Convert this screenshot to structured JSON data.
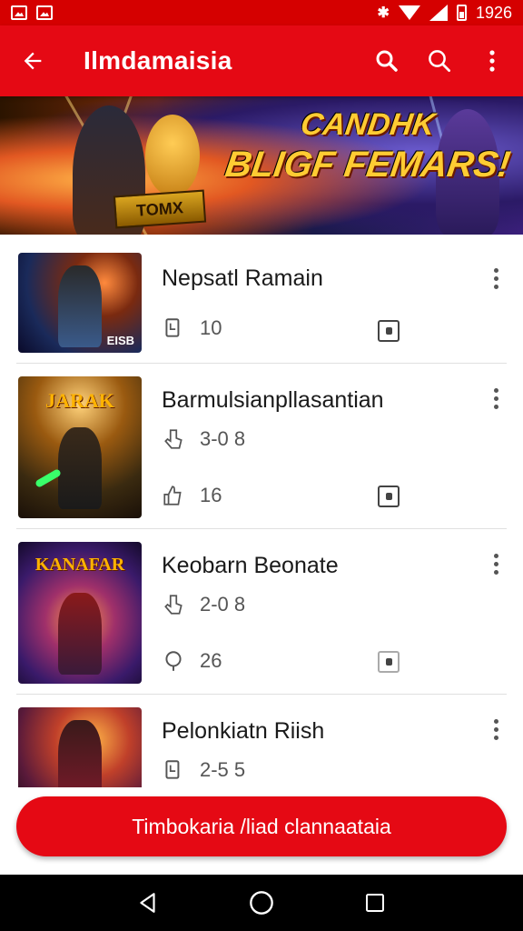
{
  "status_bar": {
    "time": "1926",
    "icons": [
      "image-icon",
      "image-icon",
      "bluetooth-icon",
      "wifi-icon",
      "cell-signal-icon",
      "battery-icon"
    ]
  },
  "app_bar": {
    "title": "Ilmdamaisia",
    "back_icon": "arrow-left-icon",
    "actions": [
      "search-icon",
      "search-icon",
      "more-vert-icon"
    ],
    "color": "#e50914"
  },
  "banner": {
    "line1": "CANDHK",
    "line2": "BLIGF FEMARS!",
    "badge": "TOMX"
  },
  "items": [
    {
      "title": "Nepsatl Ramain",
      "thumb_title": "",
      "thumb_caption": "EISB",
      "meta1": "",
      "meta2": "10"
    },
    {
      "title": "Barmulsianpllasantian",
      "thumb_title": "JARAK",
      "thumb_caption": "",
      "meta1": "3-0 8",
      "meta2": "16"
    },
    {
      "title": "Keobarn Beonate",
      "thumb_title": "KANAFAR",
      "thumb_caption": "",
      "meta1": "2-0 8",
      "meta2": "26"
    },
    {
      "title": "Pelonkiatn Riish",
      "thumb_title": "",
      "thumb_caption": "",
      "meta1": "",
      "meta2": "2-5 5"
    }
  ],
  "cta": {
    "label": "Timbokaria /liad clannaataia",
    "color": "#e50914"
  },
  "nav": [
    "back-triangle-icon",
    "home-circle-icon",
    "recents-square-icon"
  ]
}
